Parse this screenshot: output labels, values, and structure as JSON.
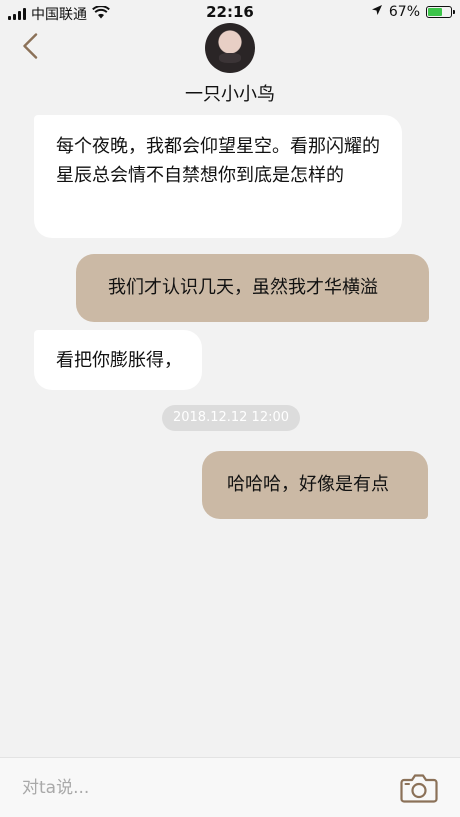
{
  "status_bar": {
    "carrier": "中国联通",
    "time": "22:16",
    "battery_percent": "67%",
    "battery_level": 0.67,
    "icons": [
      "signal-icon",
      "wifi-icon",
      "location-arrow-icon",
      "battery-icon"
    ],
    "battery_color": "#3cc44a"
  },
  "header": {
    "back_icon": "chevron-left-icon",
    "contact_name": "一只小小鸟"
  },
  "messages": [
    {
      "direction": "incoming",
      "text": "每个夜晚，我都会仰望星空。看那闪耀的星辰总会情不自禁想你到底是怎样的"
    },
    {
      "direction": "outgoing",
      "text": "我们才认识几天，虽然我才华横溢"
    },
    {
      "direction": "incoming",
      "text": "看把你膨胀得，"
    },
    {
      "direction": "outgoing",
      "text": "哈哈哈，好像是有点"
    }
  ],
  "timestamp": "2018.12.12   12:00",
  "composer": {
    "placeholder": "对ta说...",
    "camera_icon": "camera-icon"
  },
  "colors": {
    "background": "#f2f2f2",
    "incoming_bubble": "#ffffff",
    "outgoing_bubble": "#cbb9a5",
    "accent_brown": "#8b7158"
  }
}
